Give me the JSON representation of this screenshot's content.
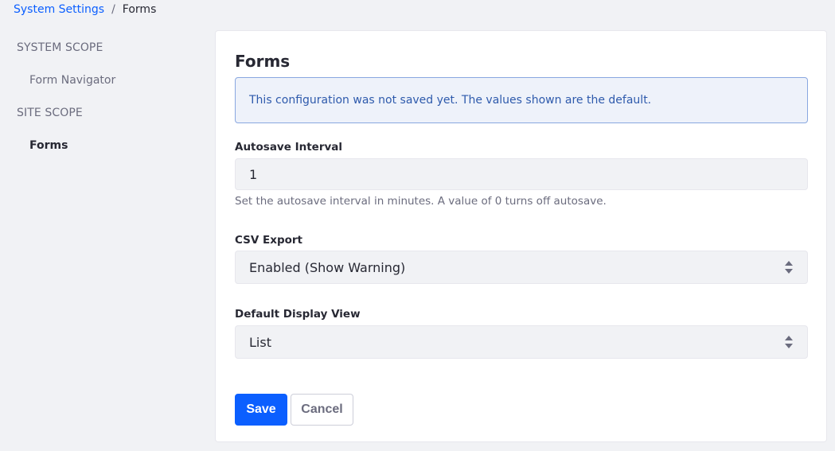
{
  "breadcrumb": {
    "parent": "System Settings",
    "separator": "/",
    "current": "Forms"
  },
  "sidebar": {
    "system_scope": "SYSTEM SCOPE",
    "system_items": [
      {
        "label": "Form Navigator"
      }
    ],
    "site_scope": "SITE SCOPE",
    "site_items": [
      {
        "label": "Forms",
        "active": true
      }
    ]
  },
  "panel": {
    "title": "Forms",
    "alert": "This configuration was not saved yet. The values shown are the default.",
    "autosave": {
      "label": "Autosave Interval",
      "value": "1",
      "help": "Set the autosave interval in minutes. A value of 0 turns off autosave."
    },
    "csv_export": {
      "label": "CSV Export",
      "value": "Enabled (Show Warning)"
    },
    "display_view": {
      "label": "Default Display View",
      "value": "List"
    },
    "save_label": "Save",
    "cancel_label": "Cancel"
  },
  "colors": {
    "primary": "#0b5fff",
    "alert_bg": "#eef2fa",
    "alert_border": "#89a7e0",
    "alert_text": "#2e5aac",
    "page_bg": "#f1f2f5"
  },
  "icons": {
    "select_arrows": "select-arrows-icon"
  }
}
